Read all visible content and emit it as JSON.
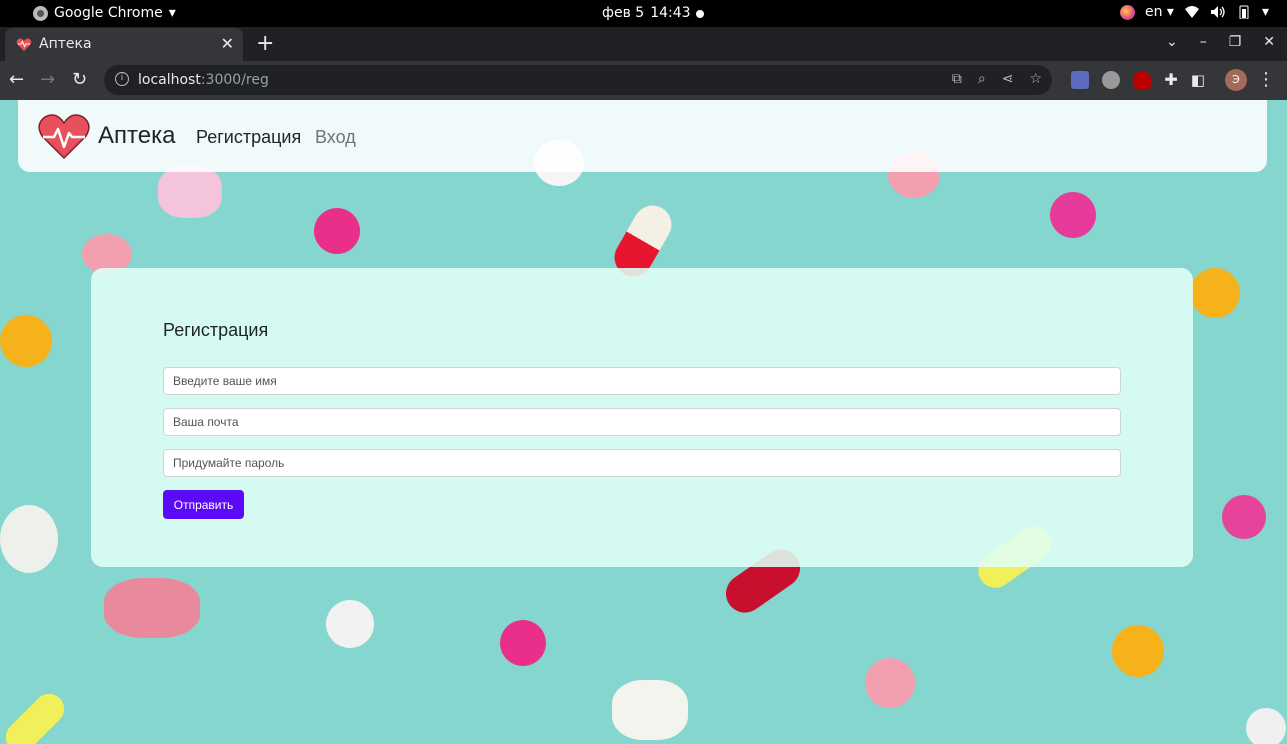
{
  "os": {
    "app_name": "Google Chrome",
    "date": "фев 5",
    "time": "14:43",
    "lang": "en"
  },
  "browser": {
    "tab_title": "Аптека",
    "url_host": "localhost",
    "url_path": ":3000/reg",
    "avatar_letter": "Э"
  },
  "site": {
    "brand": "Аптека",
    "nav": {
      "register": "Регистрация",
      "login": "Вход"
    }
  },
  "form": {
    "title": "Регистрация",
    "name_placeholder": "Введите ваше имя",
    "email_placeholder": "Ваша почта",
    "password_placeholder": "Придумайте пароль",
    "submit_label": "Отправить"
  },
  "colors": {
    "accent": "#5b0af5",
    "background": "#86d6d0"
  }
}
